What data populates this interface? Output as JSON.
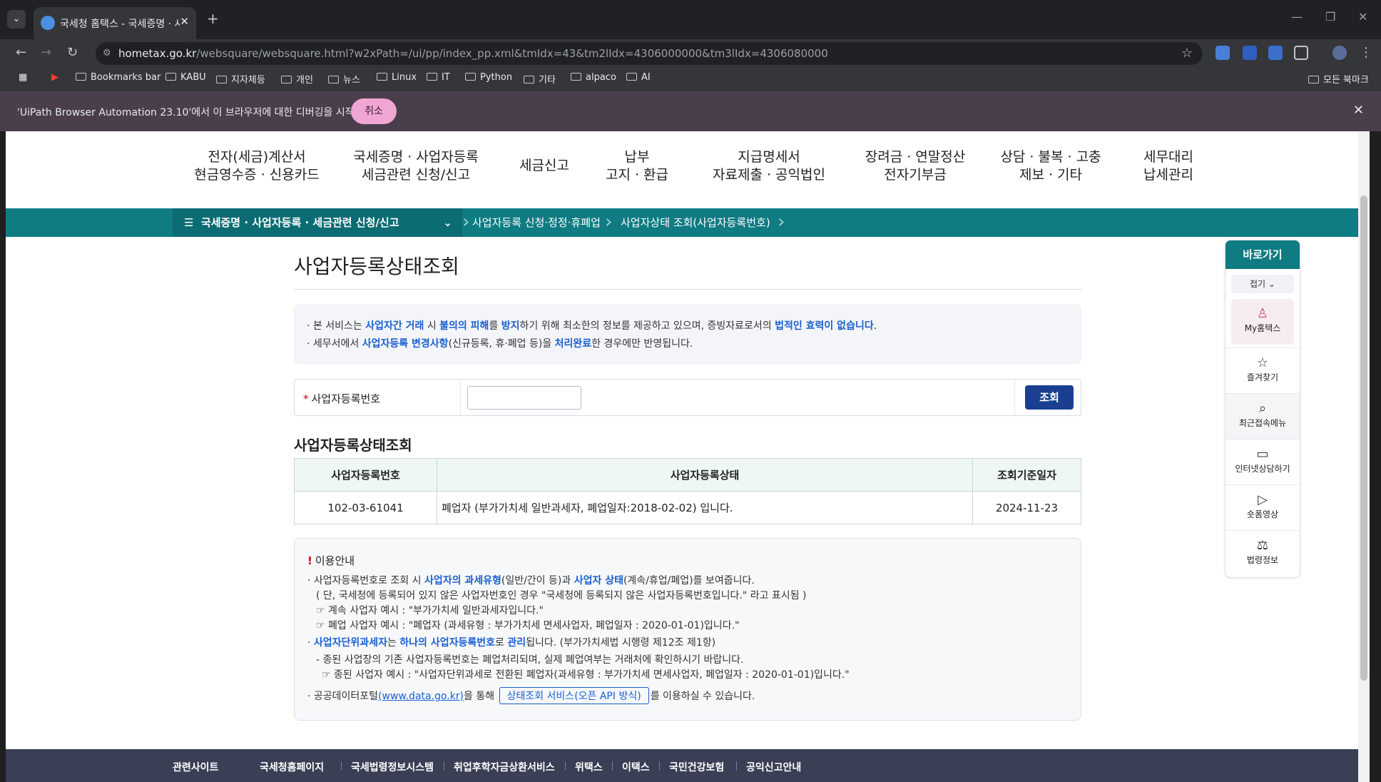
{
  "browser": {
    "tab_title": "국세청 홈택스 - 국세증명 · 사업",
    "tab_close": "✕",
    "new_tab": "+",
    "url_host": "hometax.go.kr",
    "url_path": "/websquare/websquare.html?w2xPath=/ui/pp/index_pp.xml&tmIdx=43&tm2lIdx=4306000000&tm3lIdx=4306080000",
    "bookmarks": [
      "Bookmarks bar",
      "KABU",
      "지자체등",
      "개인",
      "뉴스",
      "Linux",
      "IT",
      "Python",
      "기타",
      "alpaco",
      "AI"
    ],
    "all_bookmarks": "모든 북마크",
    "infobar_message": "'UiPath Browser Automation 23.10'에서 이 브라우저에 대한 디버깅을 시작함",
    "infobar_cancel": "취소"
  },
  "gnb": [
    "전자(세금)계산서\n현금영수증 · 신용카드",
    "국세증명 · 사업자등록\n세금관련 신청/신고",
    "세금신고",
    "납부\n고지 · 환급",
    "지급명세서\n자료제출 · 공익법인",
    "장려금 · 연말정산\n전자기부금",
    "상담 · 불복 · 고충\n제보 · 기타",
    "세무대리\n납세관리"
  ],
  "breadcrumb": {
    "level1": "국세증명 · 사업자등록 · 세금관련 신청/신고",
    "level2": "사업자등록 신청·정정·휴폐업",
    "level3": "사업자상태 조회(사업자등록번호)"
  },
  "page_title": "사업자등록상태조회",
  "notice": {
    "l1_a": "본 서비스는 ",
    "l1_b": "사업자간 거래",
    "l1_c": " 시 ",
    "l1_d": "불의의 피해",
    "l1_e": "를 ",
    "l1_f": "방지",
    "l1_g": "하기 위해 최소한의 정보를 제공하고 있으며, 증빙자료로서의 ",
    "l1_h": "법적인 효력이 없습니다",
    "l1_i": ".",
    "l2_a": "세무서에서 ",
    "l2_b": "사업자등록 변경사항",
    "l2_c": "(신규등록, 휴·폐업 등)을 ",
    "l2_d": "처리완료",
    "l2_e": "한 경우에만 반영됩니다."
  },
  "search": {
    "label": "사업자등록번호",
    "value": "",
    "button": "조회"
  },
  "result": {
    "title": "사업자등록상태조회",
    "headers": [
      "사업자등록번호",
      "사업자등록상태",
      "조회기준일자"
    ],
    "rows": [
      [
        "102-03-61041",
        "폐업자 (부가가치세 일반과세자, 폐업일자:2018-02-02) 입니다.",
        "2024-11-23"
      ]
    ]
  },
  "guide": {
    "title": "이용안내",
    "g1_a": "사업자등록번호로 조회 시 ",
    "g1_b": "사업자의 과세유형",
    "g1_c": "(일반/간이 등)과 ",
    "g1_d": "사업자 상태",
    "g1_e": "(계속/휴업/폐업)를 보여줍니다.",
    "g2": "( 단, 국세청에 등록되어 있지 않은 사업자번호인 경우 \"국세청에 등록되지 않은 사업자등록번호입니다.\" 라고 표시됨 )",
    "g3": "계속 사업자 예시 : \"부가가치세 일반과세자입니다.\"",
    "g4": "폐업 사업자 예시 : \"폐업자 (과세유형 : 부가가치세 면세사업자, 폐업일자 : 2020-01-01)입니다.\"",
    "g5_a": "사업자단위과세자",
    "g5_b": "는 ",
    "g5_c": "하나의 사업자등록번호",
    "g5_d": "로 ",
    "g5_e": "관리",
    "g5_f": "됩니다. (부가가치세법 시행령 제12조 제1항)",
    "g6": "종된 사업장의 기존 사업자등록번호는 폐업처리되며, 실제 폐업여부는 거래처에 확인하시기 바랍니다.",
    "g7": "종된 사업자 예시 : \"사업자단위과세로 전환된 폐업자(과세유형 : 부가가치세 면세사업자, 폐업일자 : 2020-01-01)입니다.\"",
    "g8_a": "공공데이터포털",
    "g8_b": "(www.data.go.kr)",
    "g8_c": "을 통해 ",
    "g8_btn": "상태조회 서비스(오픈 API 방식)",
    "g8_d": "를 이용하실 수 있습니다."
  },
  "quick_menu": {
    "title": "바로가기",
    "fold": "접기 ⌄",
    "items": [
      "My홈택스",
      "즐겨찾기",
      "최근접속메뉴",
      "인터넷상담하기",
      "숏폼영상",
      "법령정보"
    ]
  },
  "footer": {
    "title": "관련사이트",
    "links": [
      "국세청홈페이지",
      "국세법령정보시스템",
      "취업후학자금상환서비스",
      "위택스",
      "이택스",
      "국민건강보험",
      "공익신고안내"
    ]
  }
}
